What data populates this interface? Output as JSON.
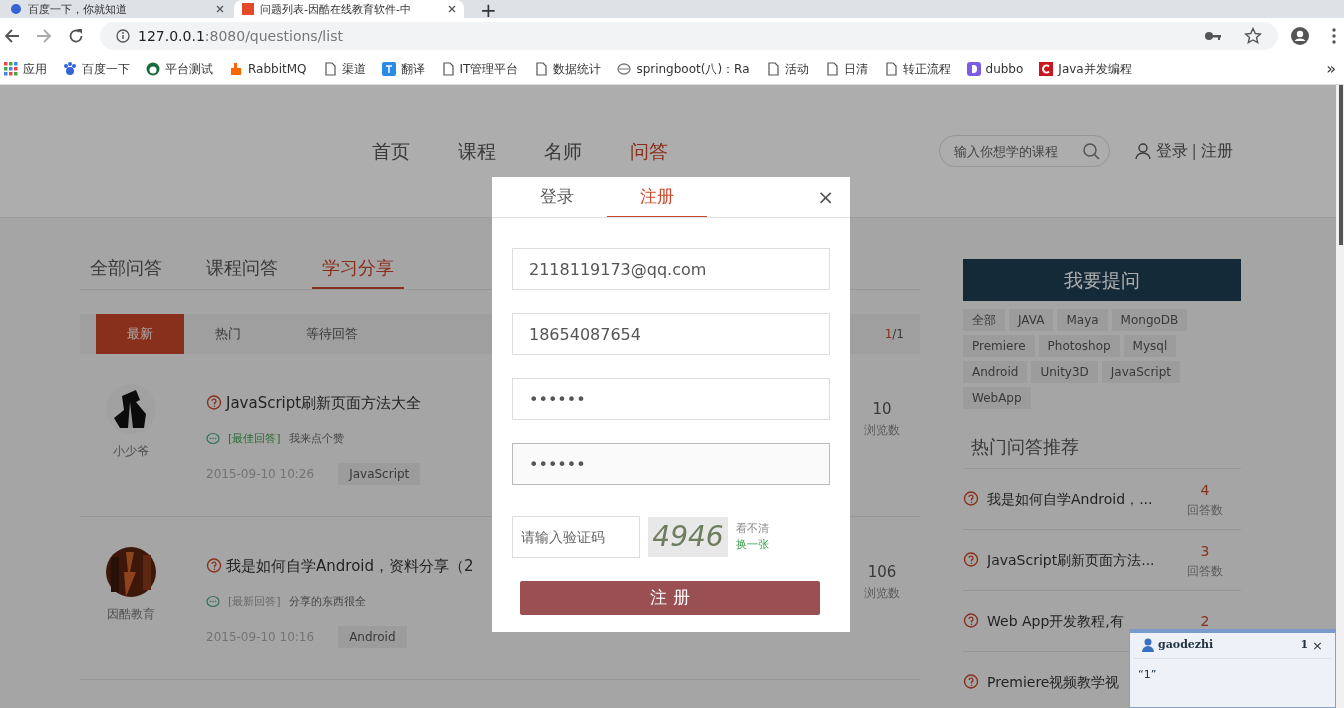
{
  "browser": {
    "tabs": [
      {
        "title": "百度一下，你就知道",
        "selected": false
      },
      {
        "title": "问题列表-因酷在线教育软件-中",
        "selected": true
      }
    ],
    "new_tab": "+",
    "url": {
      "host": "127.0.0.1",
      "rest": ":8080/questions/list"
    },
    "bookmarks": [
      {
        "label": "应用"
      },
      {
        "label": "百度一下"
      },
      {
        "label": "平台测试"
      },
      {
        "label": "RabbitMQ"
      },
      {
        "label": "渠道"
      },
      {
        "label": "翻译"
      },
      {
        "label": "IT管理平台"
      },
      {
        "label": "数据统计"
      },
      {
        "label": "springboot(八)：Ra"
      },
      {
        "label": "活动"
      },
      {
        "label": "日清"
      },
      {
        "label": "转正流程"
      },
      {
        "label": "dubbo"
      },
      {
        "label": "Java并发编程"
      }
    ],
    "more": "»"
  },
  "site": {
    "nav": [
      {
        "label": "首页",
        "selected": false
      },
      {
        "label": "课程",
        "selected": false
      },
      {
        "label": "名师",
        "selected": false
      },
      {
        "label": "问答",
        "selected": true
      }
    ],
    "search": {
      "placeholder": "输入你想学的课程"
    },
    "login": "登录",
    "separator": "|",
    "register": "注册"
  },
  "category_tabs": [
    {
      "label": "全部问答",
      "selected": false
    },
    {
      "label": "课程问答",
      "selected": false
    },
    {
      "label": "学习分享",
      "selected": true
    }
  ],
  "sort_tabs": [
    {
      "label": "最新",
      "selected": true
    },
    {
      "label": "热门",
      "selected": false
    },
    {
      "label": "等待回答",
      "selected": false
    }
  ],
  "pager": {
    "current": "1",
    "total": "/1"
  },
  "questions": [
    {
      "author": "小少爷",
      "title": "JavaScript刷新页面方法大全",
      "highlighted": true,
      "answer_label": "[最佳回答]",
      "answer": "我来点个赞",
      "time": "2015-09-10 10:26",
      "tag": "JavaScript",
      "count": "10",
      "count_label": "浏览数"
    },
    {
      "author": "因酷教育",
      "title": "我是如何自学Android，资料分享（2",
      "highlighted": false,
      "answer_label": "[最新回答]",
      "answer": "分享的东西很全",
      "time": "2015-09-10 10:16",
      "tag": "Android",
      "count": "106",
      "count_label": "浏览数"
    }
  ],
  "ask_button": "我要提问",
  "tags": [
    "全部",
    "JAVA",
    "Maya",
    "MongoDB",
    "Premiere",
    "Photoshop",
    "Mysql",
    "Android",
    "Unity3D",
    "JavaScript",
    "WebApp"
  ],
  "hot": {
    "title": "热门问答推荐",
    "items": [
      {
        "title": "我是如何自学Android，...",
        "count": "4",
        "count_label": "回答数"
      },
      {
        "title": "JavaScript刷新页面方法...",
        "count": "3",
        "count_label": "回答数"
      },
      {
        "title": "Web App开发教程,有",
        "count": "2"
      },
      {
        "title": "Premiere视频教学视"
      }
    ]
  },
  "modal": {
    "tabs": [
      {
        "label": "登录",
        "selected": false
      },
      {
        "label": "注册",
        "selected": true
      }
    ],
    "close": "×",
    "fields": [
      {
        "value": "2118119173@qq.com",
        "focused": false
      },
      {
        "value": "18654087654",
        "focused": false
      },
      {
        "value": "••••••",
        "focused": false
      },
      {
        "value": "••••••",
        "focused": true
      }
    ],
    "captcha": {
      "placeholder": "请输入验证码",
      "image_text": "4946",
      "hint": "看不清",
      "refresh": "换一张"
    },
    "submit": "注 册"
  },
  "chat": {
    "user": "gaodezhi",
    "count": "1",
    "close": "×",
    "message": "“1”"
  }
}
